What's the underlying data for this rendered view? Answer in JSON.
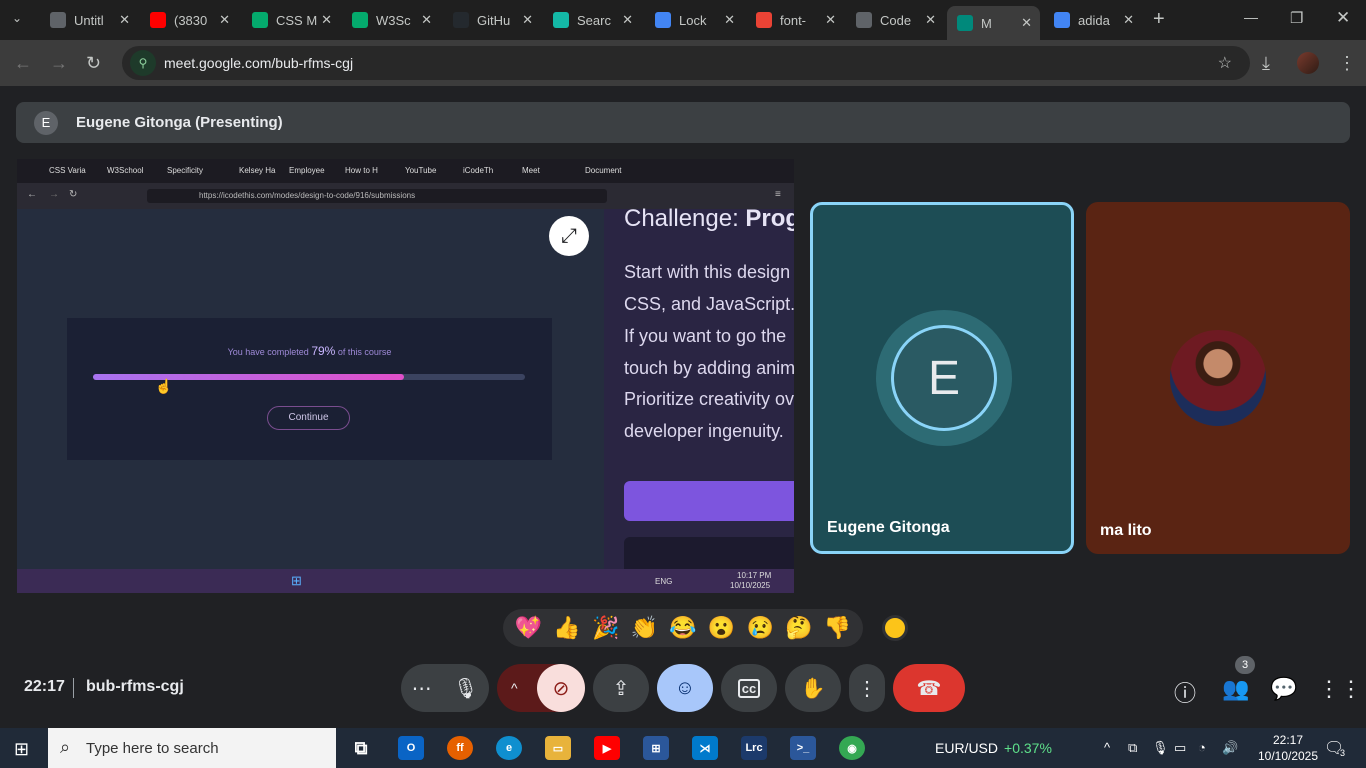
{
  "browser": {
    "tabs": [
      {
        "title": "Untitl",
        "icon": "globe-icon",
        "color": "#5f6368"
      },
      {
        "title": "(3830",
        "icon": "youtube-icon",
        "color": "#ff0000"
      },
      {
        "title": "CSS M",
        "icon": "w3schools-icon",
        "color": "#04aa6d"
      },
      {
        "title": "W3Sc",
        "icon": "w3schools-icon",
        "color": "#04aa6d"
      },
      {
        "title": "GitHu",
        "icon": "github-icon",
        "color": "#24292e"
      },
      {
        "title": "Searc",
        "icon": "vercel-icon",
        "color": "#14b8a6"
      },
      {
        "title": "Lock",
        "icon": "bookmark-icon",
        "color": "#4285f4"
      },
      {
        "title": "font-",
        "icon": "code-icon",
        "color": "#ea4335"
      },
      {
        "title": "Code",
        "icon": "globe-icon",
        "color": "#5f6368"
      },
      {
        "title": "M",
        "icon": "meet-icon",
        "color": "#00897b",
        "active": true
      },
      {
        "title": "adida",
        "icon": "google-icon",
        "color": "#4285f4"
      }
    ],
    "new_tab": "+",
    "url": "meet.google.com/bub-rfms-cgj"
  },
  "meet": {
    "presenting_initial": "E",
    "presenting_label": "Eugene Gitonga (Presenting)",
    "shared_screen": {
      "firefox_tabs": [
        "CSS Varia",
        "W3School",
        "Specificity",
        "Kelsey Ha",
        "Employee",
        "How to H",
        "YouTube",
        "iCodeTh",
        "Meet",
        "Document"
      ],
      "url": "https://icodethis.com/modes/design-to-code/916/submissions",
      "progress_prefix": "You have completed",
      "progress_value": "79%",
      "progress_suffix": "of this course",
      "progress_fraction": 0.72,
      "continue_label": "Continue",
      "challenge_label": "Challenge:",
      "challenge_bold": "Prog",
      "body_lines": [
        "Start with this design",
        "CSS, and JavaScript.",
        "If you want to go the",
        "touch by adding anim",
        "Prioritize creativity ove",
        "developer ingenuity."
      ],
      "tray_lang": "ENG",
      "tray_time": "10:17 PM",
      "tray_date": "10/10/2025"
    },
    "participants": [
      {
        "name": "Eugene Gitonga",
        "initial": "E"
      },
      {
        "name": "ma lito"
      }
    ],
    "reactions": [
      "💖",
      "👍",
      "🎉",
      "👏",
      "😂",
      "😮",
      "😢",
      "🤔",
      "👎"
    ],
    "clock": "22:17",
    "meeting_code": "bub-rfms-cgj",
    "people_count": "3"
  },
  "taskbar": {
    "search_placeholder": "Type here to search",
    "currency_label": "EUR/USD",
    "currency_change": "+0.37%",
    "time": "22:17",
    "date": "10/10/2025",
    "notifications": "3"
  }
}
